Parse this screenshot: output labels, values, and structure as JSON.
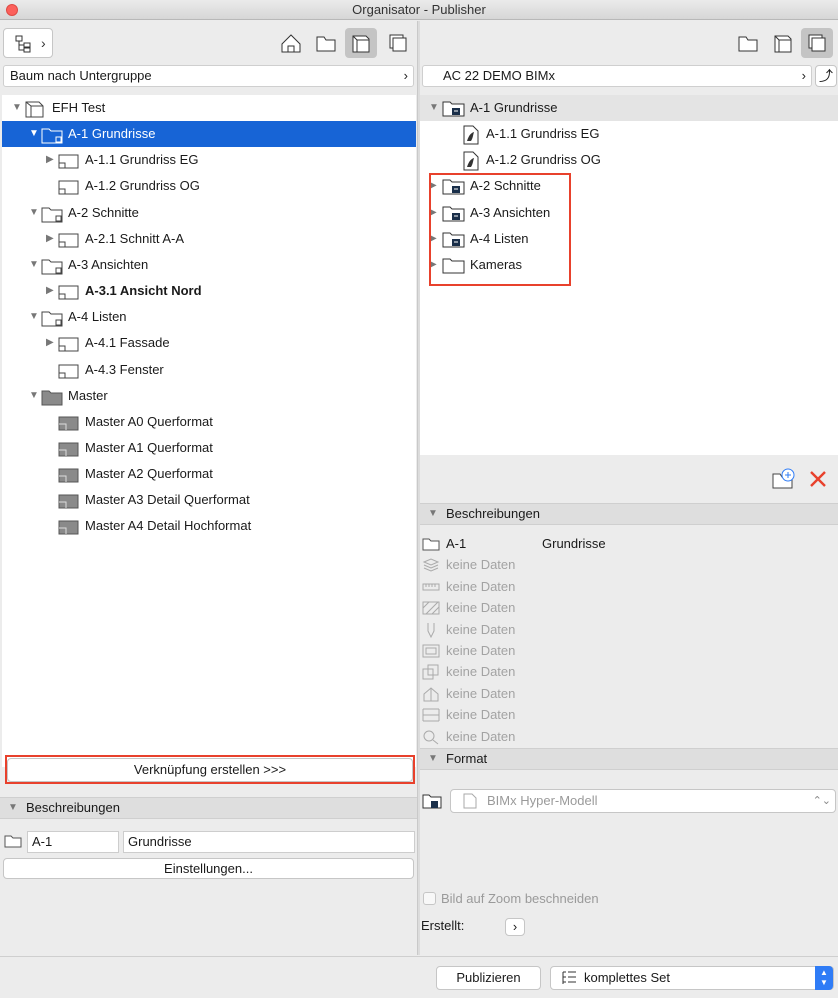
{
  "window": {
    "title": "Organisator - Publisher"
  },
  "left": {
    "path": "Baum nach Untergruppe",
    "tree": [
      {
        "label": "EFH Test",
        "level": 0,
        "expanded": true,
        "icon": "project-book-icon"
      },
      {
        "label": "A-1 Grundrisse",
        "level": 1,
        "expanded": true,
        "selected": true,
        "icon": "folder-icon"
      },
      {
        "label": "A-1.1 Grundriss EG",
        "level": 2,
        "expanded": false,
        "icon": "layout-icon"
      },
      {
        "label": "A-1.2 Grundriss OG",
        "level": 2,
        "leaf": true,
        "icon": "layout-icon"
      },
      {
        "label": "A-2 Schnitte",
        "level": 1,
        "expanded": true,
        "icon": "folder-icon"
      },
      {
        "label": "A-2.1 Schnitt A-A",
        "level": 2,
        "expanded": false,
        "icon": "layout-icon"
      },
      {
        "label": "A-3 Ansichten",
        "level": 1,
        "expanded": true,
        "icon": "folder-icon"
      },
      {
        "label": "A-3.1 Ansicht Nord",
        "level": 2,
        "expanded": false,
        "bold": true,
        "icon": "layout-icon"
      },
      {
        "label": "A-4 Listen",
        "level": 1,
        "expanded": true,
        "icon": "folder-icon"
      },
      {
        "label": "A-4.1 Fassade",
        "level": 2,
        "expanded": false,
        "icon": "layout-icon"
      },
      {
        "label": "A-4.3 Fenster",
        "level": 2,
        "leaf": true,
        "icon": "layout-icon"
      },
      {
        "label": "Master",
        "level": 1,
        "expanded": true,
        "icon": "master-folder-icon"
      },
      {
        "label": "Master A0 Querformat",
        "level": 2,
        "leaf": true,
        "icon": "master-layout-icon"
      },
      {
        "label": "Master A1 Querformat",
        "level": 2,
        "leaf": true,
        "icon": "master-layout-icon"
      },
      {
        "label": "Master A2 Querformat",
        "level": 2,
        "leaf": true,
        "icon": "master-layout-icon"
      },
      {
        "label": "Master A3 Detail Querformat",
        "level": 2,
        "leaf": true,
        "icon": "master-layout-icon"
      },
      {
        "label": "Master A4 Detail Hochformat",
        "level": 2,
        "leaf": true,
        "icon": "master-layout-icon"
      }
    ],
    "link_button": "Verknüpfung erstellen >>>",
    "desc_header": "Beschreibungen",
    "desc_id": "A-1",
    "desc_name": "Grundrisse",
    "settings_button": "Einstellungen..."
  },
  "right": {
    "path": "AC 22 DEMO BIMx",
    "tree": [
      {
        "label": "A-1 Grundrisse",
        "level": 0,
        "expanded": true,
        "header": true,
        "icon": "publisher-folder-icon"
      },
      {
        "label": "A-1.1 Grundriss EG",
        "level": 1,
        "leaf": true,
        "icon": "bimx-file-icon"
      },
      {
        "label": "A-1.2 Grundriss OG",
        "level": 1,
        "leaf": true,
        "icon": "bimx-file-icon"
      },
      {
        "label": "A-2 Schnitte",
        "level": 0,
        "expanded": false,
        "icon": "publisher-folder-icon"
      },
      {
        "label": "A-3 Ansichten",
        "level": 0,
        "expanded": false,
        "icon": "publisher-folder-icon"
      },
      {
        "label": "A-4 Listen",
        "level": 0,
        "expanded": false,
        "icon": "publisher-folder-icon"
      },
      {
        "label": "Kameras",
        "level": 0,
        "expanded": false,
        "icon": "plain-folder-icon"
      }
    ],
    "desc_header": "Beschreibungen",
    "desc_rows": [
      {
        "icon": "folder-icon",
        "key": "A-1",
        "value": "Grundrisse",
        "grey": false
      },
      {
        "icon": "layers-icon",
        "key": "keine Daten",
        "value": "",
        "grey": true
      },
      {
        "icon": "ruler-icon",
        "key": "keine Daten",
        "value": "",
        "grey": true
      },
      {
        "icon": "hatch-icon",
        "key": "keine Daten",
        "value": "",
        "grey": true
      },
      {
        "icon": "pen-icon",
        "key": "keine Daten",
        "value": "",
        "grey": true
      },
      {
        "icon": "frame-icon",
        "key": "keine Daten",
        "value": "",
        "grey": true
      },
      {
        "icon": "stack-icon",
        "key": "keine Daten",
        "value": "",
        "grey": true
      },
      {
        "icon": "house-icon",
        "key": "keine Daten",
        "value": "",
        "grey": true
      },
      {
        "icon": "dimension-icon",
        "key": "keine Daten",
        "value": "",
        "grey": true
      },
      {
        "icon": "zoom-icon",
        "key": "keine Daten",
        "value": "",
        "grey": true
      }
    ],
    "format_header": "Format",
    "format_value": "BIMx Hyper-Modell",
    "crop_label": "Bild auf Zoom beschneiden",
    "created_label": "Erstellt:"
  },
  "bottom": {
    "publish_button": "Publizieren",
    "set_value": "komplettes Set"
  },
  "colors": {
    "selection": "#1764d6",
    "highlight": "#e8412c",
    "delete": "#e8412c",
    "accent": "#2f7cf6"
  }
}
